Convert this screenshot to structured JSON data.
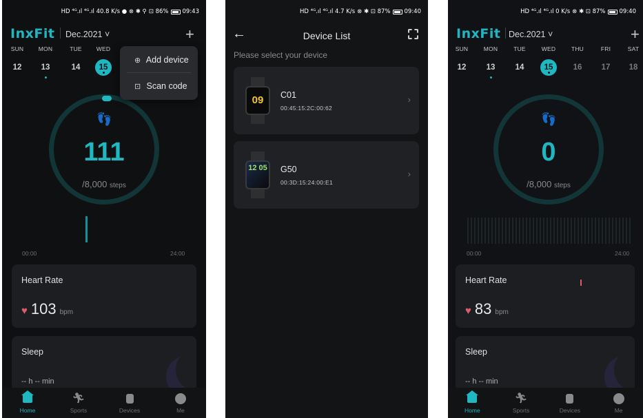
{
  "colors": {
    "accent": "#1fb7c2",
    "heart": "#e25a6a",
    "background": "#111215",
    "card": "#1d1e21"
  },
  "screen1": {
    "status": {
      "left": "HD ⁴ᴳ.ıl ⁴ᴳ.ıl 40.8 K/s ● ⊗ ✱ ⚲",
      "right": "⊡ 86%",
      "time": "09:43"
    },
    "brand": "InxFit",
    "month": "Dec.2021 ˅",
    "plus_icon": "+",
    "days": [
      {
        "name": "SUN",
        "date": "12"
      },
      {
        "name": "MON",
        "date": "13"
      },
      {
        "name": "TUE",
        "date": "14"
      },
      {
        "name": "WED",
        "date": "15"
      }
    ],
    "menu": {
      "add_device": "Add device",
      "scan_code": "Scan code",
      "add_icon": "⊕",
      "scan_icon": "⊡"
    },
    "steps": "111",
    "goal": "/8,000",
    "goal_unit": "steps",
    "time_start": "00:00",
    "time_end": "24:00",
    "heart_rate": {
      "title": "Heart Rate",
      "value": "103",
      "unit": "bpm"
    },
    "sleep": {
      "title": "Sleep",
      "value": "-- h -- min"
    }
  },
  "screen2": {
    "status": {
      "left": "HD ⁴ᴳ.ıl ⁴ᴳ.ıl 4.7 K/s",
      "right": "⊗ ✱ ⊡ 87%",
      "time": "09:40"
    },
    "title": "Device List",
    "back_icon": "←",
    "hint": "Please select your device",
    "devices": [
      {
        "name": "C01",
        "mac": "00:45:15:2C:00:62",
        "face": "09"
      },
      {
        "name": "G50",
        "mac": "00:3D:15:24:00:E1",
        "face": "12 05"
      }
    ],
    "chevron": "›"
  },
  "screen3": {
    "status": {
      "left": "HD ⁴ᴳ.ıl ⁴ᴳ.ıl 0 K/s",
      "right": "⊗ ✱ ⊡ 87%",
      "time": "09:40"
    },
    "brand": "InxFit",
    "month": "Dec.2021 ˅",
    "plus_icon": "+",
    "days": [
      {
        "name": "SUN",
        "date": "12"
      },
      {
        "name": "MON",
        "date": "13"
      },
      {
        "name": "TUE",
        "date": "14"
      },
      {
        "name": "WED",
        "date": "15"
      },
      {
        "name": "THU",
        "date": "16"
      },
      {
        "name": "FRI",
        "date": "17"
      },
      {
        "name": "SAT",
        "date": "18"
      }
    ],
    "steps": "0",
    "goal": "/8,000",
    "goal_unit": "steps",
    "time_start": "00:00",
    "time_end": "24:00",
    "heart_rate": {
      "title": "Heart Rate",
      "value": "83",
      "unit": "bpm"
    },
    "sleep": {
      "title": "Sleep",
      "value": "-- h -- min"
    }
  },
  "tabs": [
    {
      "label": "Home",
      "icon": "home-icon"
    },
    {
      "label": "Sports",
      "icon": "running-icon"
    },
    {
      "label": "Devices",
      "icon": "watch-icon"
    },
    {
      "label": "Me",
      "icon": "profile-icon"
    }
  ]
}
